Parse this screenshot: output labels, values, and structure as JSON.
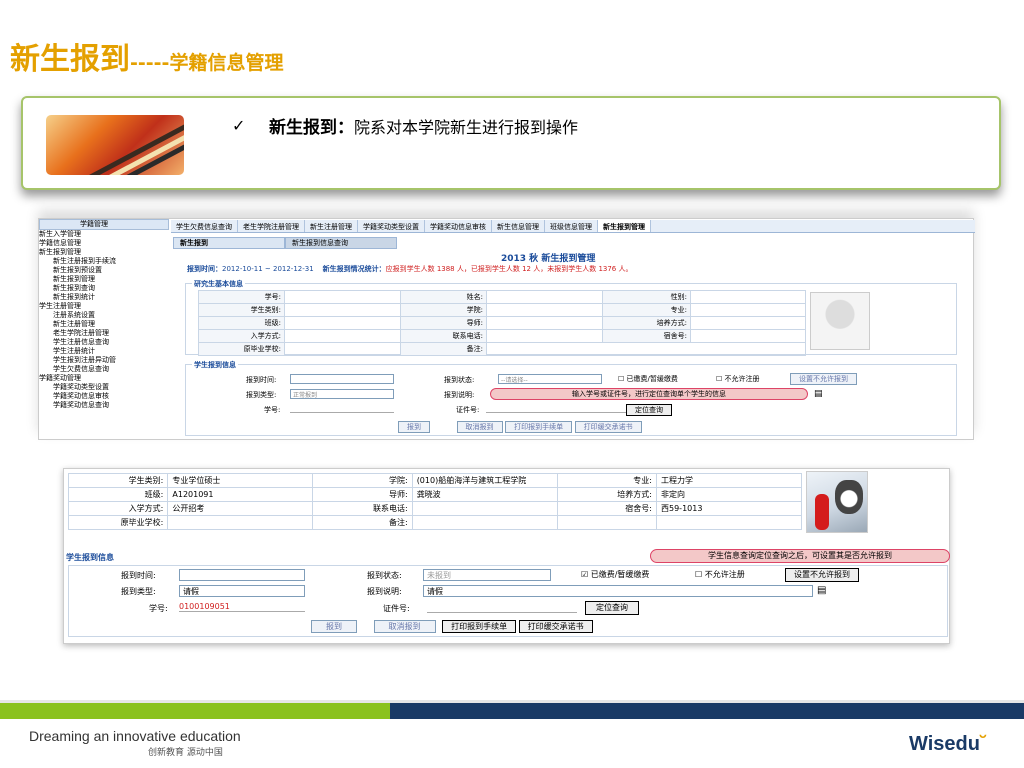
{
  "slide": {
    "title_main": "新生报到",
    "title_dash": "-----",
    "title_sub": "学籍信息管理",
    "bullet_heading": "新生报到：",
    "bullet_text": "院系对本学院新生进行报到操作"
  },
  "tree": {
    "header": "学籍管理",
    "items": [
      "新生入学管理",
      "学籍信息管理",
      "新生报到管理",
      "新生注册报到手续流",
      "新生报到预设置",
      "新生报到管理",
      "新生报到查询",
      "新生报到统计",
      "学生注册管理",
      "注册系统设置",
      "新生注册管理",
      "老生学院注册管理",
      "学生注册信息查询",
      "学生注册统计",
      "学生报到注册异动管",
      "学生欠费信息查询",
      "学籍奖动管理",
      "学籍奖动类型设置",
      "学籍奖动信息审核",
      "学籍奖动信息查询"
    ]
  },
  "tabs": [
    "学生欠费信息查询",
    "老生学院注册管理",
    "新生注册管理",
    "学籍奖动类型设置",
    "学籍奖动信息审核",
    "新生信息管理",
    "班级信息管理",
    "新生报到管理"
  ],
  "subtabs": [
    "新生报到",
    "新生报到信息查询"
  ],
  "panel": {
    "heading": "2013 秋 新生报到管理",
    "period_label": "报到时间：",
    "period_value": "2012-10-11 ~ 2012-12-31",
    "stats_label": "新生报到情况统计：",
    "stats_value": "应报到学生人数 1388 人，已报到学生人数 12 人，未报到学生人数 1376 人。",
    "basic_legend": "研究生基本信息",
    "basic_labels": [
      "学号:",
      "姓名:",
      "性别:",
      "学生类别:",
      "学院:",
      "专业:",
      "班级:",
      "导师:",
      "培养方式:",
      "入学方式:",
      "联系电话:",
      "宿舍号:",
      "原毕业学校:",
      "备注:"
    ],
    "reg_legend": "学生报到信息",
    "reg_time": "报到时间:",
    "reg_status": "报到状态:",
    "reg_status_val": "--请选择--",
    "paid": "已缴费/暂缓缴费",
    "disallow": "不允许注册",
    "set_disallow": "设置不允许报到",
    "reg_type": "报到类型:",
    "reg_type_val": "正常报到",
    "reg_note": "报到说明:",
    "callout1": "输入学号或证件号，进行定位查询单个学生的信息",
    "sid": "学号:",
    "cert": "证件号:",
    "locate": "定位查询",
    "btn_reg": "报到",
    "btn_cancel": "取消报到",
    "btn_print1": "打印报到手续单",
    "btn_print2": "打印缓交承诺书"
  },
  "detail": {
    "rows": [
      [
        "学生类别:",
        "专业学位硕士",
        "学院:",
        "(010)船舶海洋与建筑工程学院",
        "专业:",
        "工程力学"
      ],
      [
        "班级:",
        "A1201091",
        "导师:",
        "龚晓波",
        "培养方式:",
        "非定向"
      ],
      [
        "入学方式:",
        "公开招考",
        "联系电话:",
        "",
        "宿舍号:",
        "西59-1013"
      ],
      [
        "原毕业学校:",
        "",
        "备注:",
        "",
        "",
        ""
      ]
    ],
    "reg_legend": "学生报到信息",
    "callout2": "学生信息查询定位查询之后，可设置其是否允许报到",
    "reg_time": "报到时间:",
    "reg_status": "报到状态:",
    "reg_status_val": "未报到",
    "paid": "已缴费/暂缓缴费",
    "disallow": "不允许注册",
    "set_disallow": "设置不允许报到",
    "reg_type": "报到类型:",
    "reg_type_val": "请假",
    "reg_note": "报到说明:",
    "reg_note_val": "请假",
    "sid": "学号:",
    "sid_val": "0100109051",
    "cert": "证件号:",
    "locate": "定位查询",
    "btn_reg": "报到",
    "btn_cancel": "取消报到",
    "btn_print1": "打印报到手续单",
    "btn_print2": "打印缓交承诺书"
  },
  "footer": {
    "slogan": "Dreaming an innovative education",
    "slogan_cn": "创新教育 源动中国",
    "logo": "Wisedu"
  },
  "colors": {
    "title": "#e4a000",
    "accent_green": "#8ac21e",
    "navy": "#1a3a66",
    "border_green": "#a6c46a"
  }
}
